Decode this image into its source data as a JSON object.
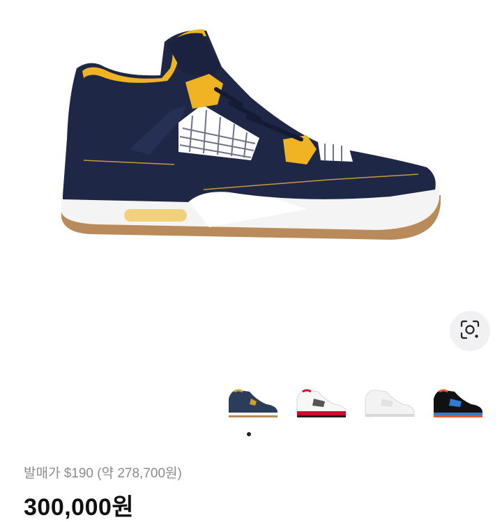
{
  "gallery": {
    "icons": {
      "lens": "visual-search-icon"
    },
    "thumbnails": [
      {
        "name": "dunk-from-above-thumbnail",
        "colors": [
          "#2c3d5c",
          "#d4a127"
        ]
      },
      {
        "name": "fire-red-thumbnail",
        "colors": [
          "#ffffff",
          "#c8102e"
        ]
      },
      {
        "name": "pure-money-thumbnail",
        "colors": [
          "#f3f3f3",
          "#d8d8d8"
        ]
      },
      {
        "name": "cactus-jack-thumbnail",
        "colors": [
          "#111111",
          "#2f7bd1"
        ]
      }
    ],
    "active_index": 0
  },
  "product": {
    "retail_price_text": "발매가 $190 (약 278,700원)",
    "price_text": "300,000원"
  }
}
